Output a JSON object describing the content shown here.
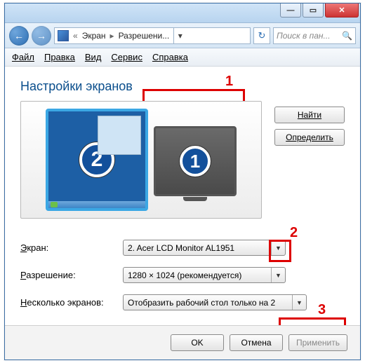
{
  "breadcrumb": {
    "item1": "Экран",
    "item2": "Разрешени..."
  },
  "search": {
    "placeholder": "Поиск в пан..."
  },
  "menu": {
    "file": "Файл",
    "edit": "Правка",
    "view": "Вид",
    "tools": "Сервис",
    "help": "Справка"
  },
  "heading": "Настройки экранов",
  "annotations": {
    "a1": "1",
    "a2": "2",
    "a3": "3"
  },
  "monitors": {
    "m1": "1",
    "m2": "2"
  },
  "side": {
    "find": "Найти",
    "detect": "Определить"
  },
  "form": {
    "screen_label": "Экран:",
    "screen_value": "2. Acer LCD Monitor AL1951",
    "resolution_label": "Разрешение:",
    "resolution_value": "1280 × 1024 (рекомендуется)",
    "multi_label": "Несколько экранов:",
    "multi_value": "Отобразить рабочий стол только на 2"
  },
  "footer": {
    "ok": "OK",
    "cancel": "Отмена",
    "apply": "Применить"
  }
}
